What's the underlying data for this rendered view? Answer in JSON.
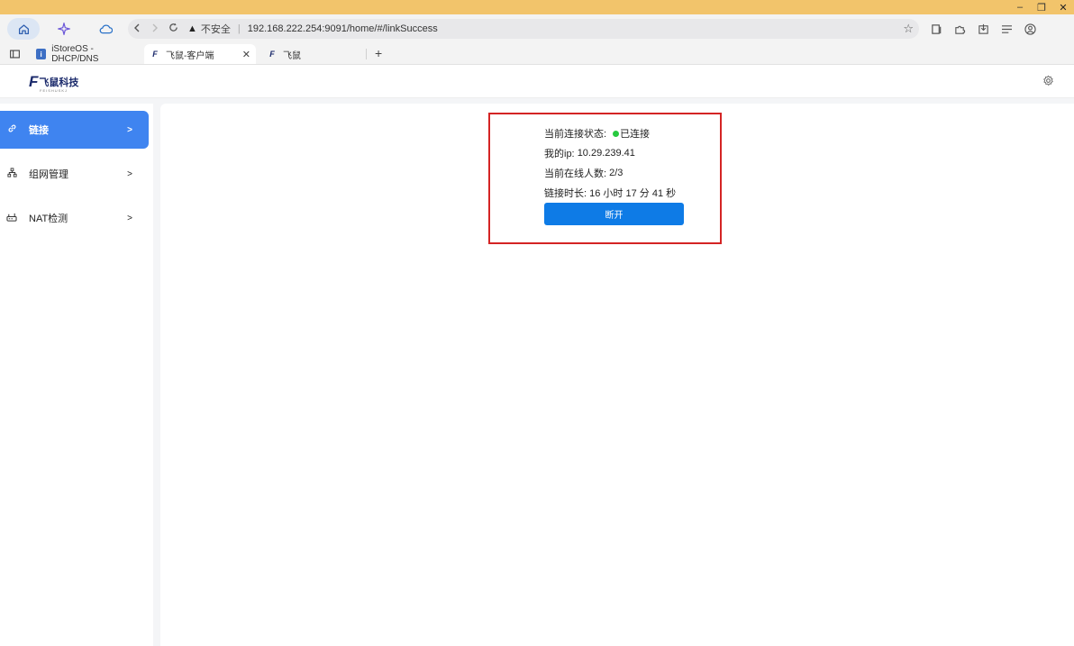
{
  "browser": {
    "window_controls": {
      "minimize": "–",
      "restore": "❐",
      "close": "✕"
    },
    "url_bar": {
      "security_label": "不安全",
      "url": "192.168.222.254:9091/home/#/linkSuccess"
    },
    "tabs": [
      {
        "label": "iStoreOS - DHCP/DNS",
        "active": false
      },
      {
        "label": "飞鼠-客户端",
        "active": true
      },
      {
        "label": "飞鼠",
        "active": false
      }
    ],
    "new_tab_label": "+"
  },
  "app": {
    "logo_text": "飞鼠科技",
    "logo_subtext": "FEISHUSKJ"
  },
  "sidebar": {
    "items": [
      {
        "label": "链接",
        "arrow": ">",
        "active": true
      },
      {
        "label": "组网管理",
        "arrow": ">",
        "active": false
      },
      {
        "label": "NAT检测",
        "arrow": ">",
        "active": false
      }
    ]
  },
  "status": {
    "connection_label": "当前连接状态:",
    "connection_value": "已连接",
    "ip_label": "我的ip:",
    "ip_value": "10.29.239.41",
    "online_label": "当前在线人数:",
    "online_value": "2/3",
    "duration_label": "链接时长:",
    "duration_value": "16 小时 17 分 41 秒",
    "disconnect_label": "断开"
  },
  "colors": {
    "accent": "#3f84f0",
    "button": "#0e7be6",
    "connected_dot": "#27c93f",
    "highlight_border": "#d42424",
    "titlebar": "#f2c46b"
  }
}
